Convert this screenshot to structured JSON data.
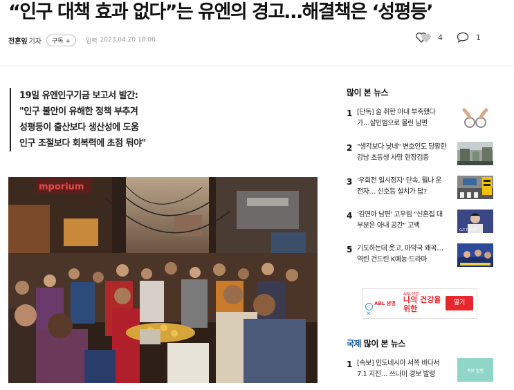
{
  "article": {
    "headline": "“인구 대책 효과 없다”는 유엔의 경고…해결책은 ‘성평등’",
    "author": "전혼잎",
    "role": "기자",
    "subscribe_label": "구독 +",
    "timestamp_label": "입력",
    "timestamp": "2023.04.20 18:00",
    "likes": "4",
    "comments": "1",
    "summary": [
      "19일 유엔인구기금 보고서 발간:",
      "\"인구 불안이 유해한 정책 부추겨",
      "성평등이 출산보다 생산성에 도움",
      "인구 조절보다 회복력에 초점 둬야\""
    ],
    "photo_sign": "mporium"
  },
  "sidebar": {
    "most_viewed_title": "많이 본 뉴스",
    "most_viewed": [
      {
        "rank": "1",
        "title": "[단독] 술 취한 아내 부축했다 가…살인범으로 몰린 남편"
      },
      {
        "rank": "2",
        "title": "\"생각보다 낮네\" 변호인도 당황한 강남 초등생 사망 현장검증"
      },
      {
        "rank": "3",
        "title": "'우회전 일시정지' 단속, 뭘나 운전자… 신호등 설치가 답?"
      },
      {
        "rank": "4",
        "title": "'김연아 남편' 고우림 \"신혼집 대부분은 아내 공간\" 고백"
      },
      {
        "rank": "5",
        "title": "기도하는데 웃고, 마약국 왜곡… 역린 건드린 K예능·드라마"
      }
    ],
    "thumb4_text": "CUT TO CUT",
    "section_label": "국제",
    "section_title": "많이 본 뉴스",
    "section_items": [
      {
        "rank": "1",
        "title": "[속보] 인도네시아 서쪽 바다서 7.1 지진… 쓰나미 경보 발령"
      }
    ],
    "section_thumb_text": "속보 알림"
  },
  "ad": {
    "brand_line": "ABL생명",
    "headline": "나의 건강을 위한",
    "logo": "ABL 생명",
    "button": "열기",
    "accent": "#e8262b"
  },
  "colors": {
    "section_accent": "#1a57a7"
  }
}
